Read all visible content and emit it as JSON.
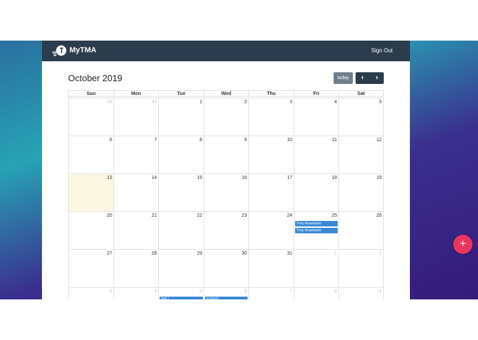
{
  "navbar": {
    "brand": "MyTMA",
    "sign_out": "Sign Out"
  },
  "header": {
    "month_title": "October 2019",
    "today_label": "today",
    "prev_label": "‹",
    "next_label": "›"
  },
  "calendar": {
    "weekdays": [
      "Sun",
      "Mon",
      "Tue",
      "Wed",
      "Thu",
      "Fri",
      "Sat"
    ],
    "today_day": 13,
    "weeks": [
      [
        {
          "day": 29,
          "other": true
        },
        {
          "day": 30,
          "other": true
        },
        {
          "day": 1
        },
        {
          "day": 2
        },
        {
          "day": 3
        },
        {
          "day": 4
        },
        {
          "day": 5
        }
      ],
      [
        {
          "day": 6
        },
        {
          "day": 7
        },
        {
          "day": 8
        },
        {
          "day": 9
        },
        {
          "day": 10
        },
        {
          "day": 11
        },
        {
          "day": 12
        }
      ],
      [
        {
          "day": 13
        },
        {
          "day": 14
        },
        {
          "day": 15
        },
        {
          "day": 16
        },
        {
          "day": 17
        },
        {
          "day": 18
        },
        {
          "day": 19
        }
      ],
      [
        {
          "day": 20
        },
        {
          "day": 21
        },
        {
          "day": 22
        },
        {
          "day": 23
        },
        {
          "day": 24
        },
        {
          "day": 25
        },
        {
          "day": 26
        }
      ],
      [
        {
          "day": 27
        },
        {
          "day": 28
        },
        {
          "day": 29
        },
        {
          "day": 30
        },
        {
          "day": 31
        },
        {
          "day": 1,
          "other": true
        },
        {
          "day": 2,
          "other": true
        }
      ],
      [
        {
          "day": 3,
          "other": true
        },
        {
          "day": 4,
          "other": true
        },
        {
          "day": 5,
          "other": true
        },
        {
          "day": 6,
          "other": true
        },
        {
          "day": 7,
          "other": true
        },
        {
          "day": 8,
          "other": true
        },
        {
          "day": 9,
          "other": true
        }
      ]
    ],
    "events": [
      {
        "week": 3,
        "col": 5,
        "slot": 0,
        "title": "Trey Anastasio"
      },
      {
        "week": 3,
        "col": 5,
        "slot": 1,
        "title": "Trey Anastasio"
      },
      {
        "week": 5,
        "col": 2,
        "slot": 0,
        "title": "WILL"
      },
      {
        "week": 5,
        "col": 3,
        "slot": 0,
        "title": "EVENT"
      }
    ]
  },
  "fab": {
    "label": "+"
  },
  "colors": {
    "navbar": "#2b3c4d",
    "event": "#3a87d6",
    "today_bg": "#fcf8e3",
    "fab": "#e8365e"
  }
}
